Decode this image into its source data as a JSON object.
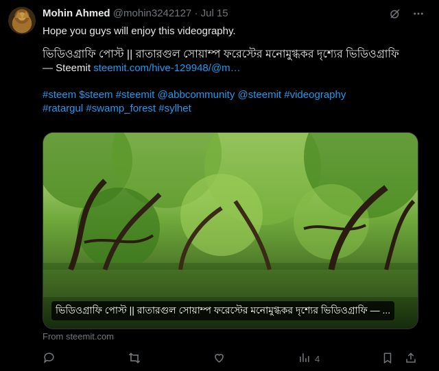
{
  "author": {
    "name": "Mohin Ahmed",
    "handle": "@mohin3242127",
    "separator": "·",
    "date": "Jul 15"
  },
  "icons": {
    "grok": "grok-icon",
    "more": "more-icon",
    "reply": "reply-icon",
    "repost": "repost-icon",
    "like": "like-icon",
    "views": "views-icon",
    "bookmark": "bookmark-icon",
    "share": "share-icon"
  },
  "tweet": {
    "line1": "Hope you guys will enjoy this videography.",
    "line2": "ভিডিওগ্রাফি পোস্ট || রাতারগুল সোয়াম্প ফরেস্টের মনোমুগ্ধকর দৃশ্যের ভিডিওগ্রাফি",
    "line3_prefix": "— Steemit ",
    "line3_link": "steemit.com/hive-129948/@m…",
    "tags_line1": "#steem $steem #steemit @abbcommunity @steemit #videography",
    "tags_line2": "#ratargul #swamp_forest #sylhet"
  },
  "card": {
    "caption": "ভিডিওগ্রাফি পোস্ট || রাতারগুল সোয়াম্প ফরেস্টের মনোমুগ্ধকর দৃশ্যের ভিডিওগ্রাফি — ...",
    "source": "From steemit.com"
  },
  "metrics": {
    "views": "4"
  },
  "colors": {
    "background": "#000000",
    "text": "#e7e9ea",
    "muted": "#71767b",
    "link": "#1d9bf0"
  }
}
